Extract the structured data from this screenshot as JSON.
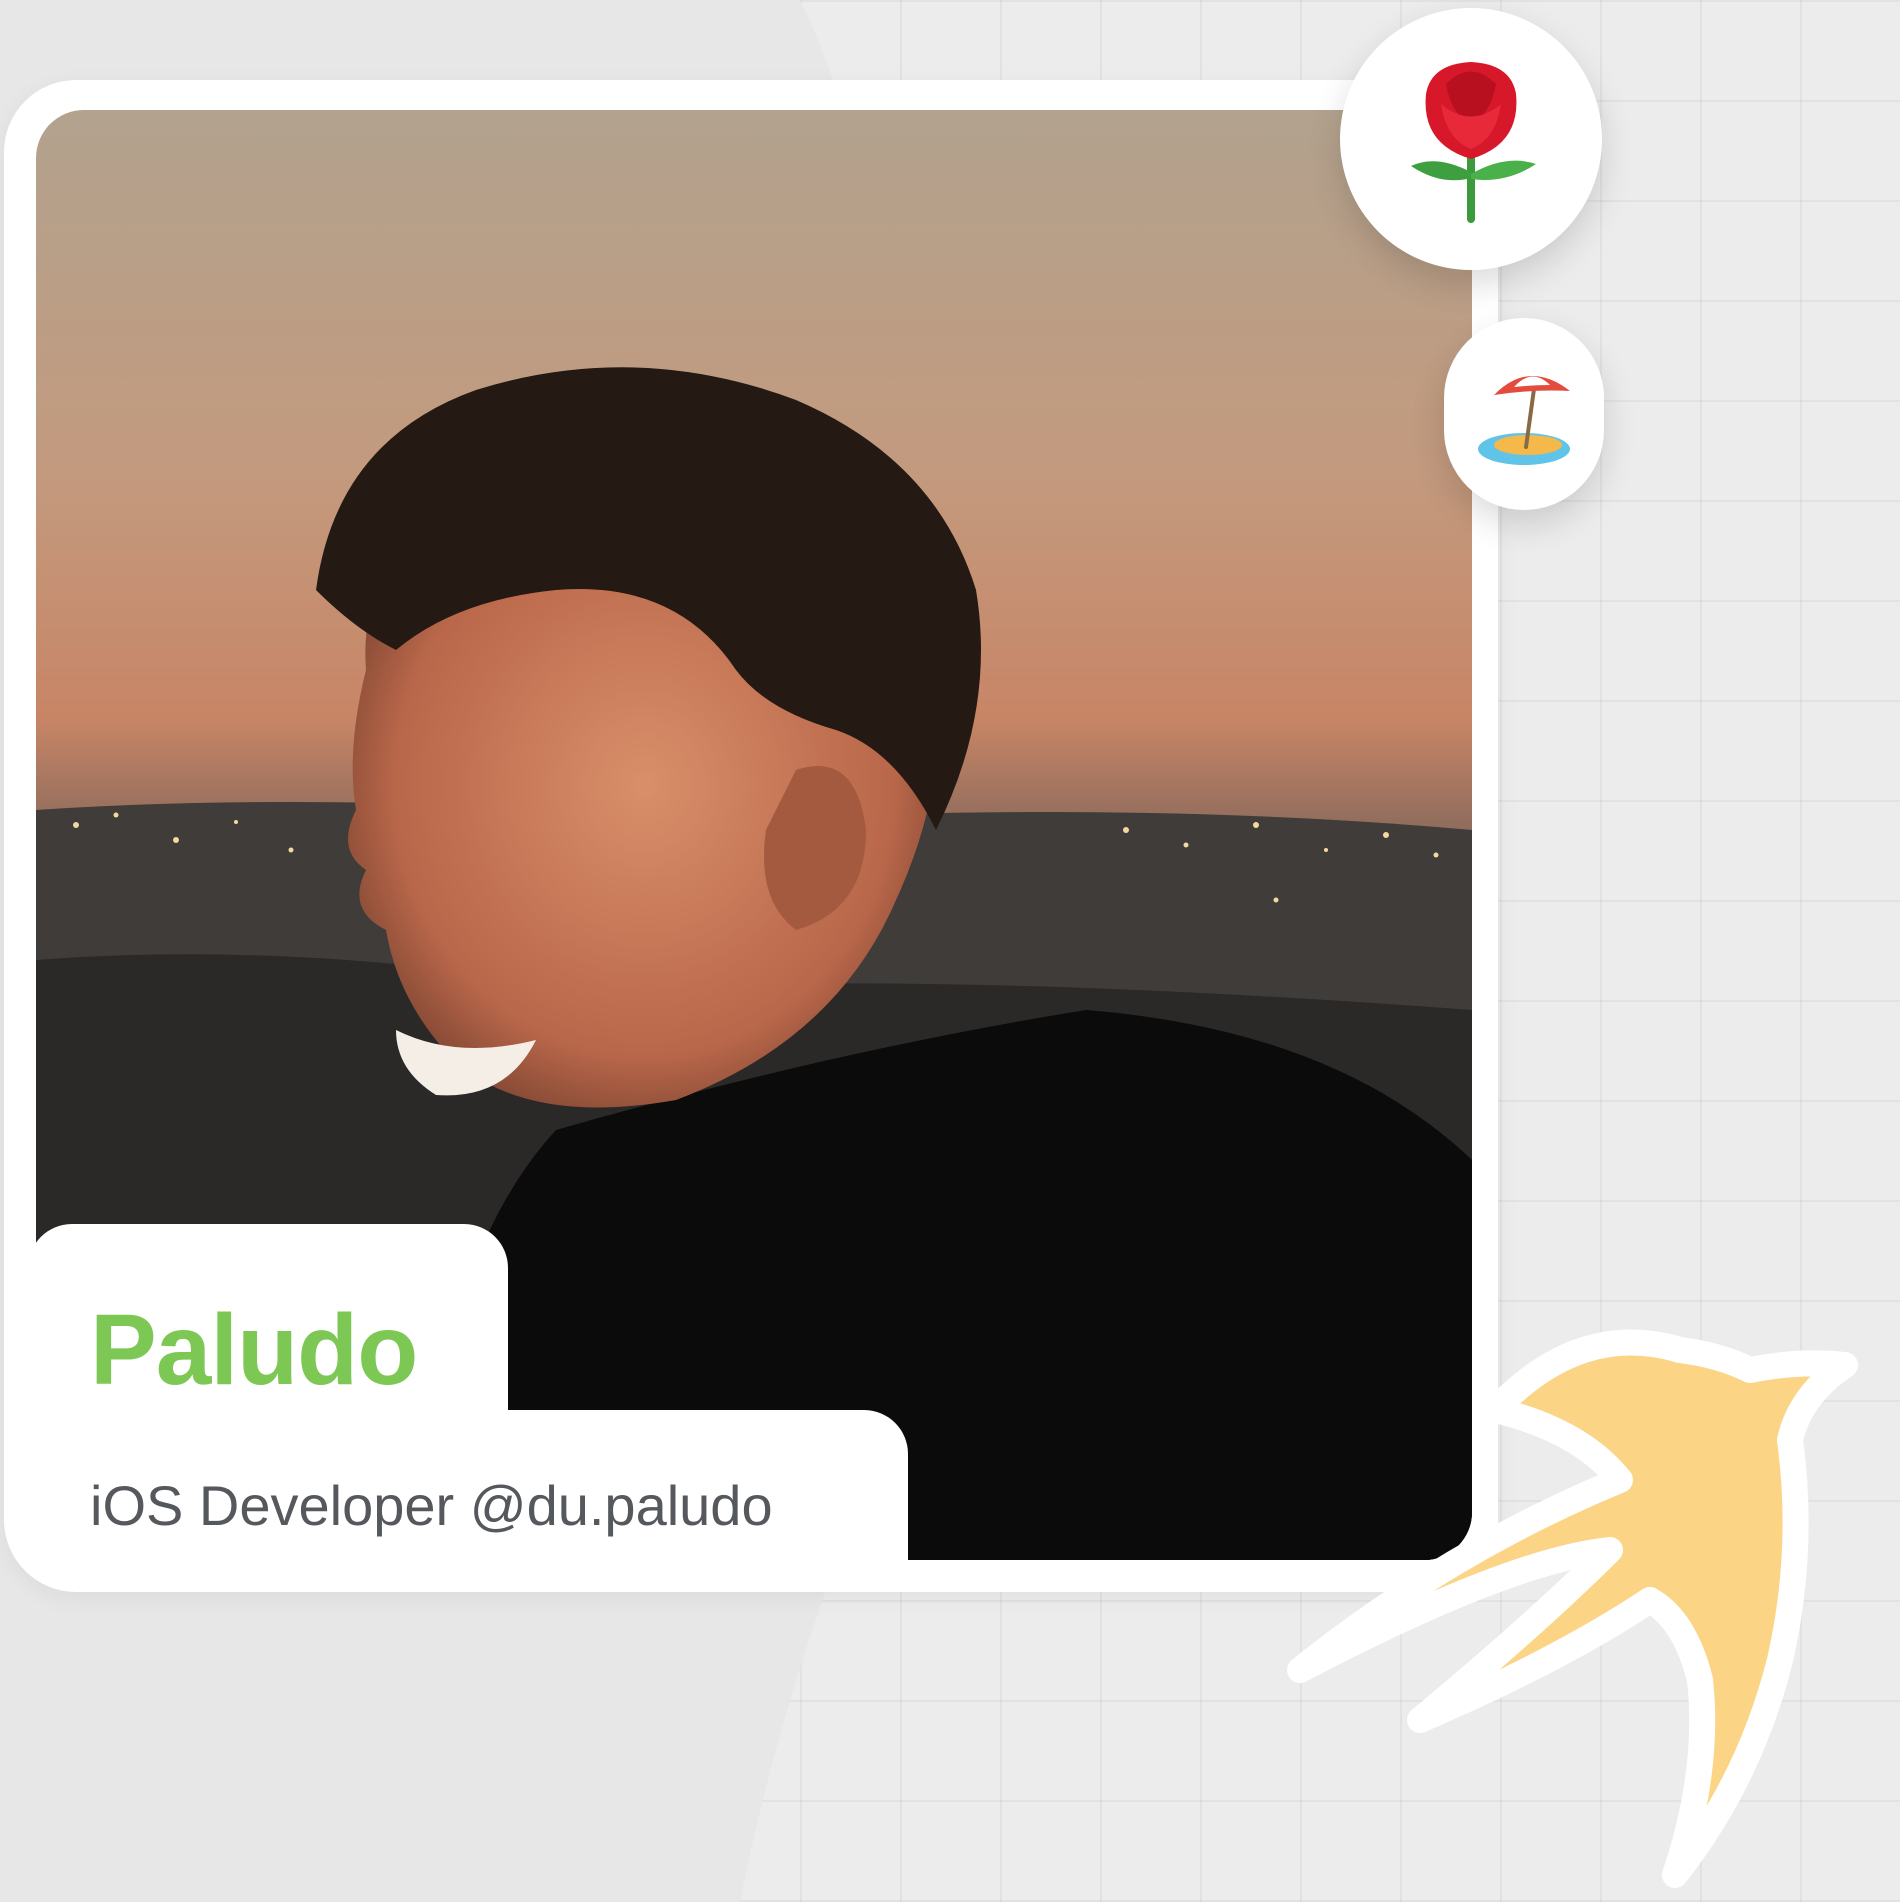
{
  "profile": {
    "name": "Paludo",
    "role": "iOS Developer @du.paludo"
  },
  "icons": {
    "badge_top": "rose-icon",
    "badge_side": "beach-umbrella-icon",
    "decoration": "swallow-bird-icon"
  },
  "colors": {
    "name": "#7dc855",
    "role": "#55585d",
    "bird": "#fbd585",
    "background": "#ececec",
    "card": "#ffffff"
  }
}
